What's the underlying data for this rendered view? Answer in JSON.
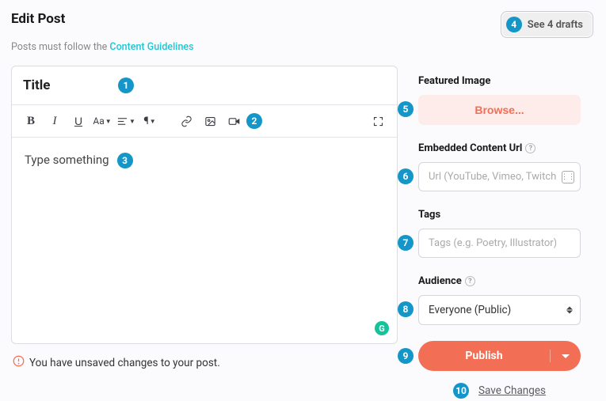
{
  "header": {
    "title": "Edit Post",
    "drafts_label": "See 4 drafts"
  },
  "subtext": {
    "prefix": "Posts must follow the ",
    "link": "Content Guidelines"
  },
  "editor": {
    "title_placeholder": "Title",
    "content_placeholder": "Type something",
    "toolbar": {
      "text_size_label": "Aa"
    }
  },
  "sidebar": {
    "featured_label": "Featured Image",
    "browse_label": "Browse...",
    "embed_label": "Embedded Content Url",
    "embed_placeholder": "Url (YouTube, Vimeo, Twitch,",
    "tags_label": "Tags",
    "tags_placeholder": "Tags (e.g. Poetry, Illustrator)",
    "audience_label": "Audience",
    "audience_value": "Everyone (Public)",
    "publish_label": "Publish",
    "save_label": "Save Changes"
  },
  "warning": {
    "text": "You have unsaved changes to your post."
  },
  "badges": [
    "1",
    "2",
    "3",
    "4",
    "5",
    "6",
    "7",
    "8",
    "9",
    "10"
  ]
}
